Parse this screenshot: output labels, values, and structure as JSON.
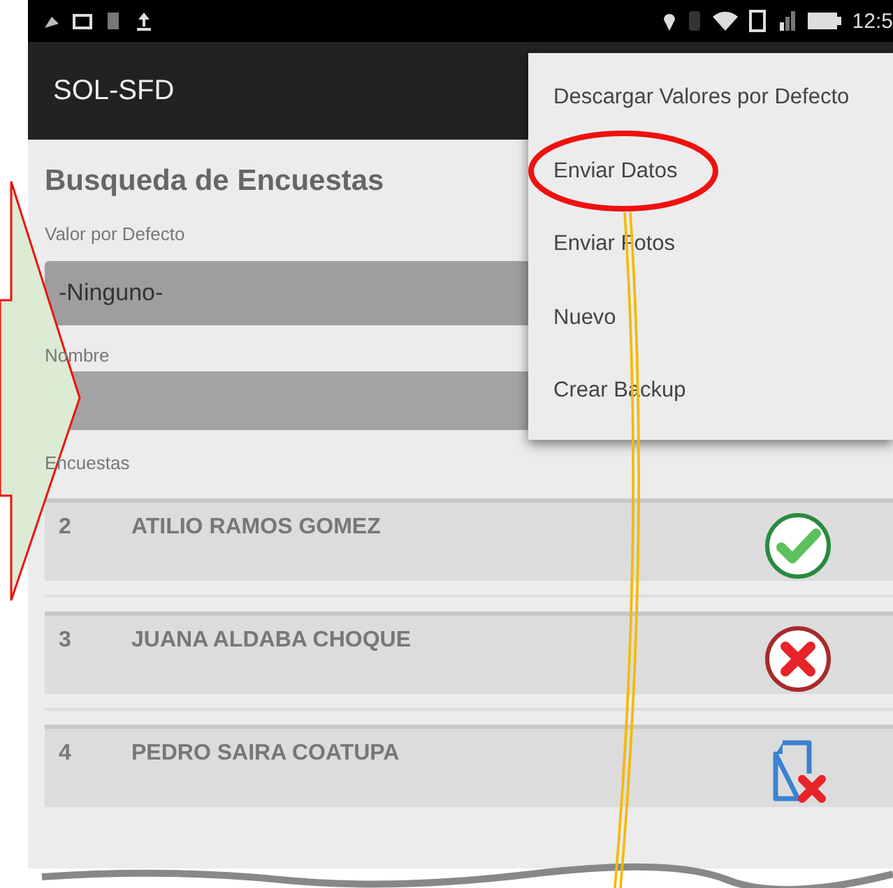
{
  "status_bar": {
    "time": "12:5"
  },
  "app_bar": {
    "title": "SOL-SFD"
  },
  "search": {
    "title": "Busqueda de Encuestas",
    "default_value": {
      "label": "Valor por Defecto",
      "value": "-Ninguno-"
    },
    "name": {
      "label": "Nombre"
    },
    "list_label": "Encuestas"
  },
  "rows": [
    {
      "number": "2",
      "name": "ATILIO RAMOS GOMEZ",
      "kind": "sent"
    },
    {
      "number": "3",
      "name": "JUANA ALDABA CHOQUE",
      "kind": "error"
    },
    {
      "number": "4",
      "name": "PEDRO SAIRA COATUPA",
      "kind": "fileerror"
    }
  ],
  "menu": [
    {
      "label": "Descargar Valores por Defecto",
      "circled": false
    },
    {
      "label": "Enviar Datos",
      "circled": true
    },
    {
      "label": "Enviar Fotos",
      "circled": false
    },
    {
      "label": "Nuevo",
      "circled": false
    },
    {
      "label": "Crear Backup",
      "circled": false
    }
  ]
}
